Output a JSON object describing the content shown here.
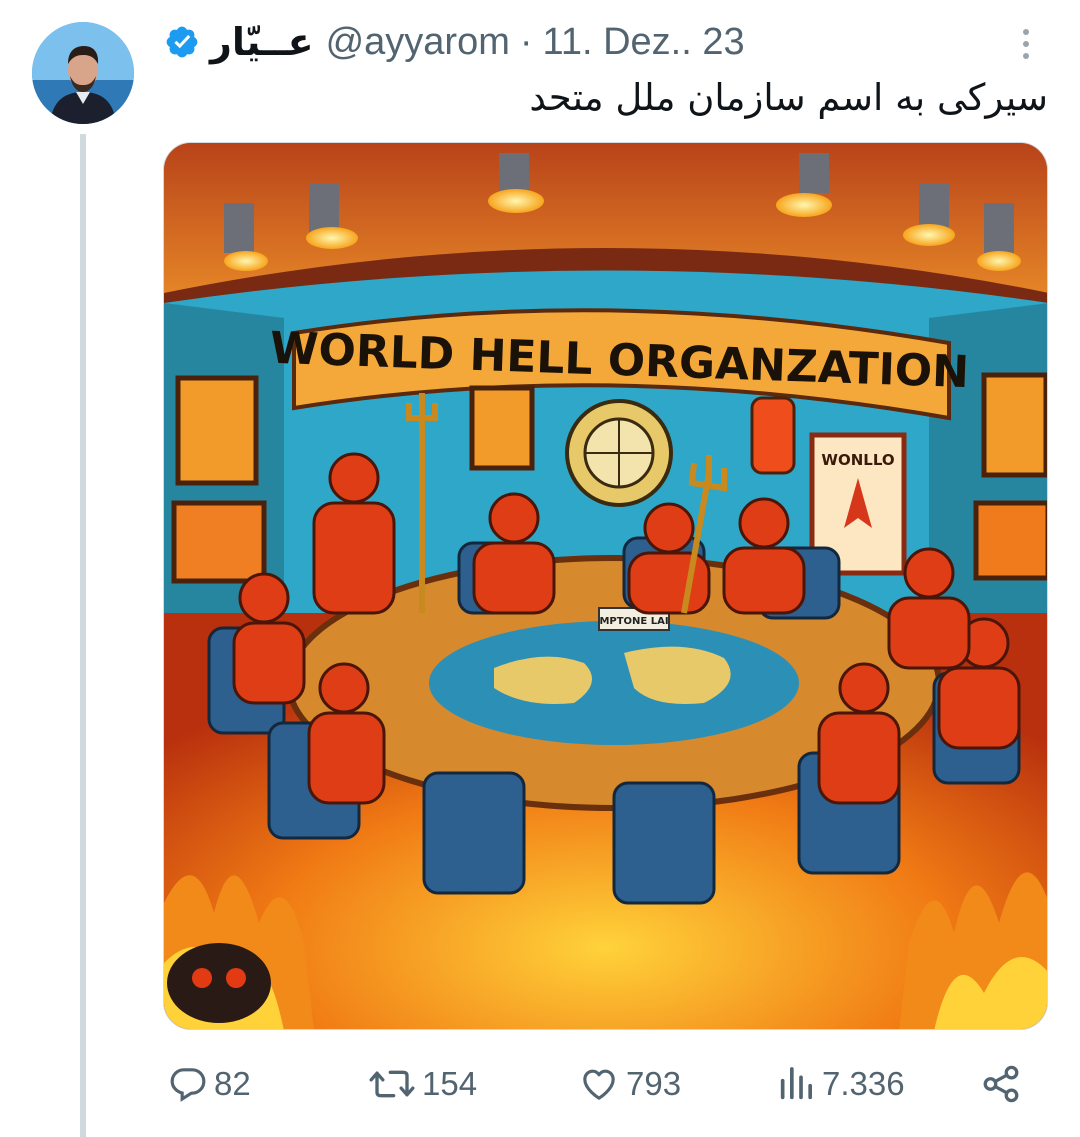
{
  "tweet": {
    "display_name": "عــیّار",
    "handle": "@ayyarom",
    "separator": "·",
    "date": "11. Dez.. 23",
    "text": "سیرکی به اسم سازمان ملل متحد",
    "verified": true
  },
  "image": {
    "banner_text": "WORLD HELL ORGANZATION",
    "poster_text": "WONLLO",
    "placard_text": "MPTONE LAI"
  },
  "actions": {
    "replies": "82",
    "reposts": "154",
    "likes": "793",
    "views": "7.336"
  },
  "colors": {
    "verified": "#1d9bf0",
    "muted": "#536471",
    "text": "#0f1419",
    "thread_line": "#cfd9de"
  },
  "icons": [
    "more-icon",
    "verified-icon",
    "reply-icon",
    "repost-icon",
    "like-icon",
    "views-icon",
    "share-icon"
  ]
}
